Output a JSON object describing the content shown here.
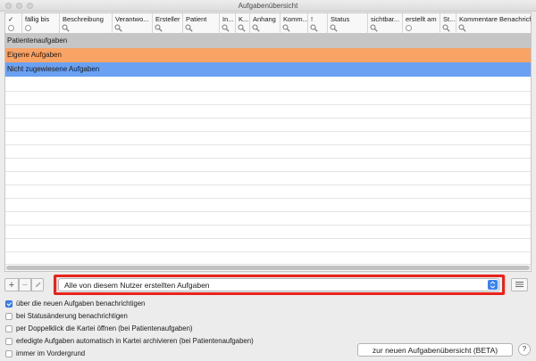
{
  "window": {
    "title": "Aufgabenübersicht"
  },
  "table": {
    "columns": [
      {
        "label": "✓",
        "filter": "radio"
      },
      {
        "label": "fällig bis",
        "filter": "radio"
      },
      {
        "label": "Beschreibung",
        "filter": "search"
      },
      {
        "label": "Verantwo...",
        "filter": "search"
      },
      {
        "label": "Ersteller",
        "filter": "search"
      },
      {
        "label": "Patient",
        "filter": "search"
      },
      {
        "label": "In...",
        "filter": "search"
      },
      {
        "label": "K...",
        "filter": "search"
      },
      {
        "label": "Anhang",
        "filter": "search"
      },
      {
        "label": "Komm...",
        "filter": "search"
      },
      {
        "label": "!",
        "filter": "search"
      },
      {
        "label": "Status",
        "filter": "search"
      },
      {
        "label": "sichtbar...",
        "filter": "search"
      },
      {
        "label": "erstellt am",
        "filter": "radio"
      },
      {
        "label": "St...",
        "filter": "search"
      },
      {
        "label": "Kommentare Benachrichtigung",
        "filter": "search"
      }
    ],
    "groups": [
      {
        "label": "Patientenaufgaben",
        "color": "#c6c6c6"
      },
      {
        "label": "Eigene Aufgaben",
        "color": "#f9a466"
      },
      {
        "label": "Nicht zugewiesene Aufgaben",
        "color": "#6aa1f2"
      }
    ]
  },
  "toolbar": {
    "add": "+",
    "remove": "−"
  },
  "filter": {
    "selected": "Alle von diesem Nutzer erstellten Aufgaben"
  },
  "options": [
    {
      "label": "über die neuen Aufgaben benachrichtigen",
      "checked": true
    },
    {
      "label": "bei Statusänderung benachrichtigen",
      "checked": false
    },
    {
      "label": "per Doppelklick die Kartei öffnen (bei Patientenaufgaben)",
      "checked": false
    },
    {
      "label": "erledigte Aufgaben automatisch in Kartei archivieren (bei Patientenaufgaben)",
      "checked": false
    },
    {
      "label": "immer im Vordergrund",
      "checked": false
    }
  ],
  "buttons": {
    "beta": "zur neuen Aufgabenübersicht (BETA)",
    "help": "?"
  },
  "colors": {
    "accent": "#3b82f6",
    "highlight": "#e8231b"
  }
}
